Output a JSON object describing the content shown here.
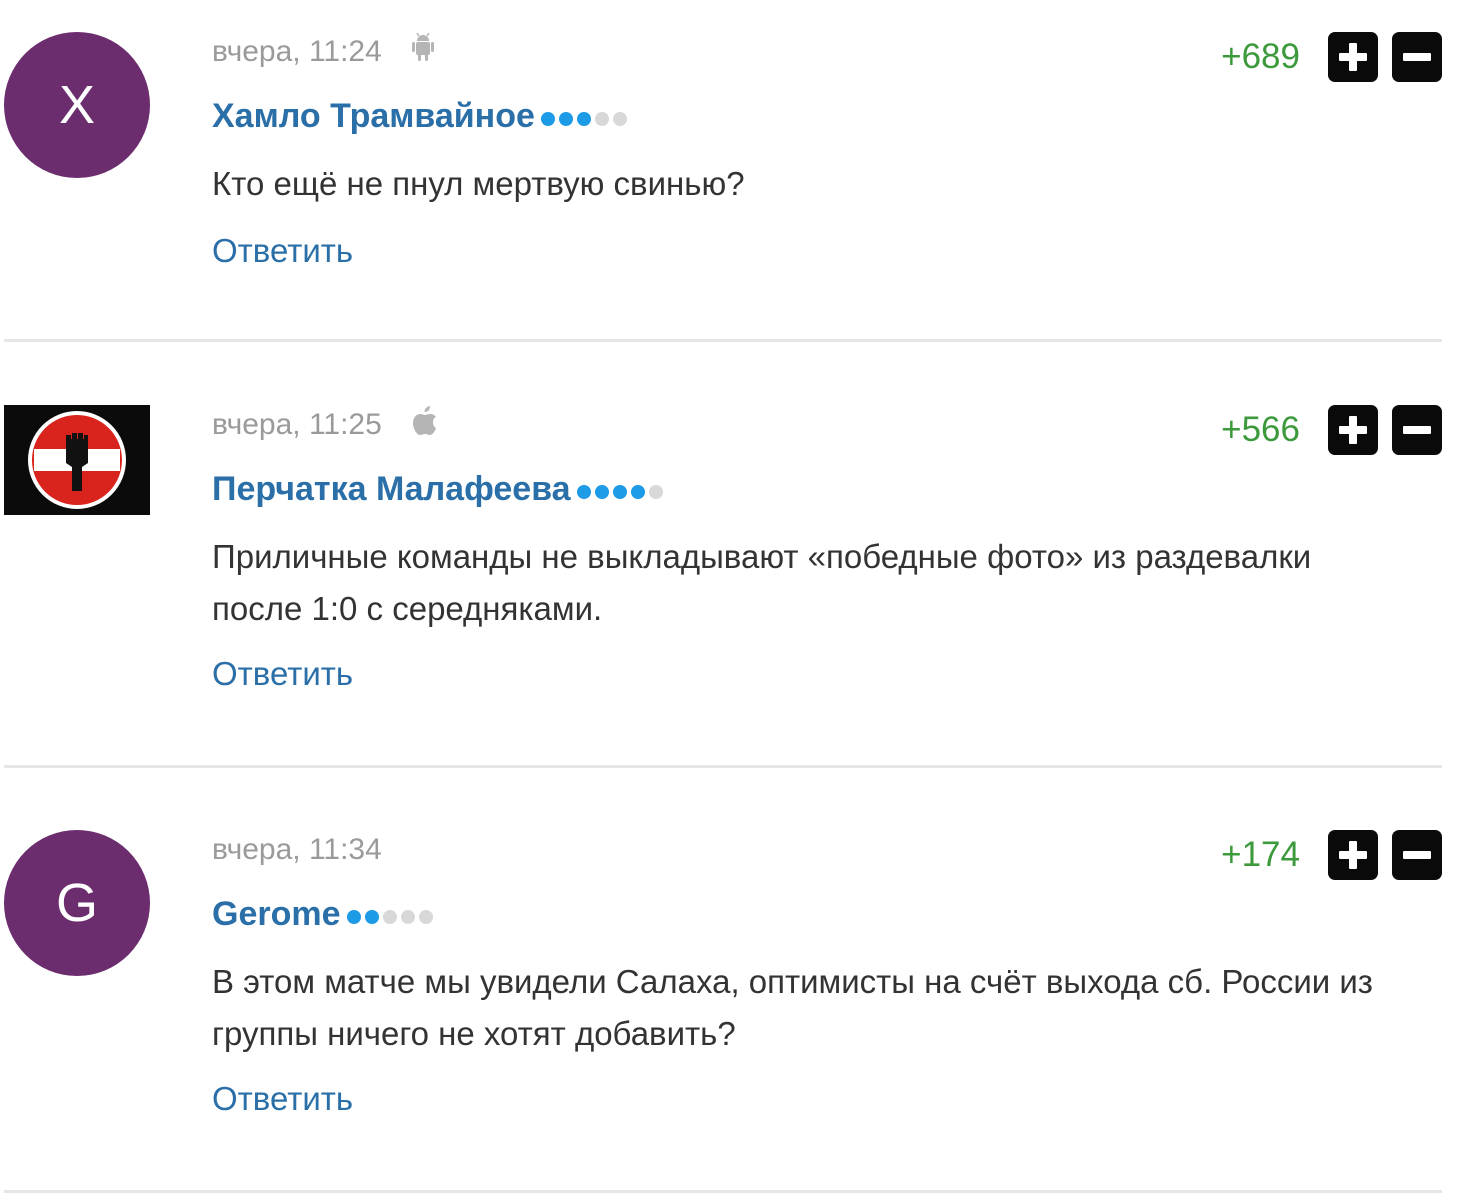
{
  "comments": [
    {
      "avatar_letter": "X",
      "avatar_color": "#6b2d6e",
      "timestamp": "вчера, 11:24",
      "device": "android-icon",
      "author": "Хамло Трамвайное",
      "rank_dots_on": 3,
      "rank_dots_total": 5,
      "score": "+689",
      "text": "Кто ещё не пнул мертвую свинью?",
      "reply": "Ответить"
    },
    {
      "avatar_letter": "",
      "avatar_color": "#0b0b0b",
      "avatar_icon": "no-entry-fist-icon",
      "timestamp": "вчера, 11:25",
      "device": "apple-icon",
      "author": "Перчатка Малафеева",
      "rank_dots_on": 4,
      "rank_dots_total": 5,
      "score": "+566",
      "text": "Приличные команды не выкладывают «победные фото» из раздевалки после 1:0 с середняками.",
      "reply": "Ответить"
    },
    {
      "avatar_letter": "G",
      "avatar_color": "#6b2d6e",
      "timestamp": "вчера, 11:34",
      "device": "",
      "author": "Gerome",
      "rank_dots_on": 2,
      "rank_dots_total": 5,
      "score": "+174",
      "text": "В этом матче мы увидели Салаха, оптимисты на счёт выхода сб. России из группы ничего не хотят добавить?",
      "reply": "Ответить"
    }
  ],
  "colors": {
    "author": "#2a6fa8",
    "score_positive": "#3c9a3c",
    "rank_on": "#1e9be6",
    "rank_off": "#d8d8d8",
    "vote_button": "#0a0a0a"
  }
}
